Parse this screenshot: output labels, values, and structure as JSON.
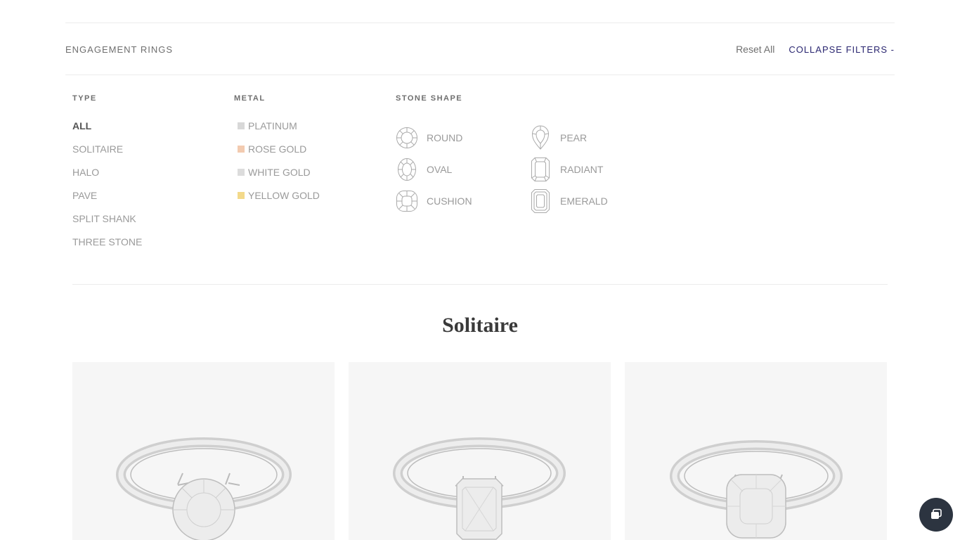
{
  "header": {
    "breadcrumb": "ENGAGEMENT RINGS",
    "reset_label": "Reset All",
    "collapse_label": "COLLAPSE FILTERS -"
  },
  "filters": {
    "type": {
      "heading": "TYPE",
      "options": [
        "ALL",
        "SOLITAIRE",
        "HALO",
        "PAVE",
        "SPLIT SHANK",
        "THREE STONE"
      ],
      "selected": "ALL"
    },
    "metal": {
      "heading": "METAL",
      "options": [
        {
          "label": "PLATINUM",
          "color": "#d8d8d8"
        },
        {
          "label": "ROSE GOLD",
          "color": "#f3cbb0"
        },
        {
          "label": "WHITE GOLD",
          "color": "#dcdcdc"
        },
        {
          "label": "YELLOW GOLD",
          "color": "#f3d98a"
        }
      ]
    },
    "stone_shape": {
      "heading": "STONE SHAPE",
      "options": [
        {
          "label": "ROUND",
          "icon": "round-diamond-icon"
        },
        {
          "label": "PEAR",
          "icon": "pear-diamond-icon"
        },
        {
          "label": "OVAL",
          "icon": "oval-diamond-icon"
        },
        {
          "label": "RADIANT",
          "icon": "radiant-diamond-icon"
        },
        {
          "label": "CUSHION",
          "icon": "cushion-diamond-icon"
        },
        {
          "label": "EMERALD",
          "icon": "emerald-diamond-icon"
        }
      ]
    }
  },
  "section": {
    "title": "Solitaire"
  },
  "products": [
    {
      "image": "solitaire-ring-round-diamond-image",
      "stone": "round"
    },
    {
      "image": "solitaire-ring-radiant-diamond-image",
      "stone": "radiant"
    },
    {
      "image": "solitaire-ring-cushion-diamond-image",
      "stone": "cushion"
    }
  ],
  "chat": {
    "icon": "chat-bubble-icon"
  },
  "colors": {
    "accent": "#2a2670",
    "card_background": "#f6f6f6",
    "chat_button": "#2c3440"
  }
}
